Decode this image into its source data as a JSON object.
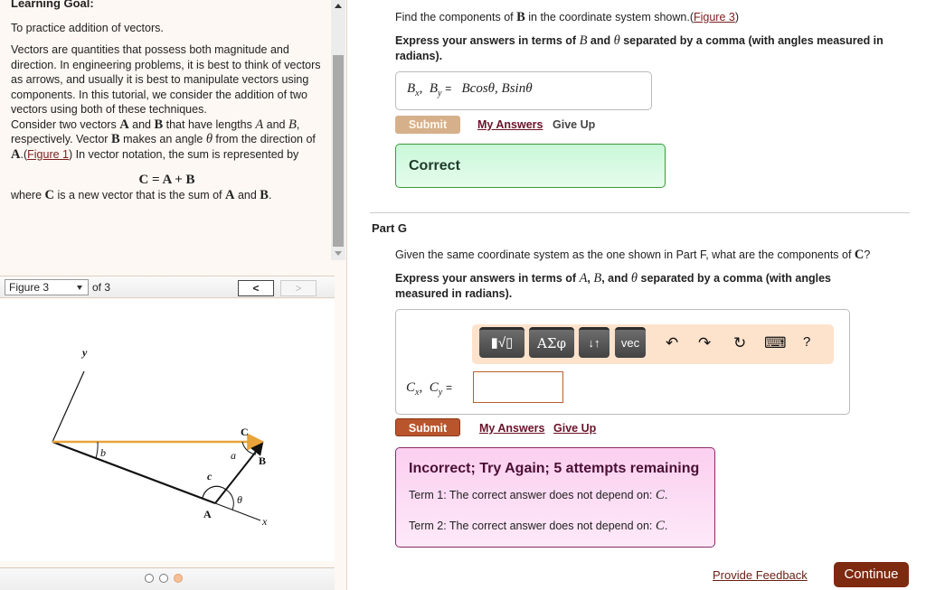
{
  "learning_goal": {
    "heading": "Learning Goal:",
    "intro": "To practice addition of vectors.",
    "paragraph1": "Vectors are quantities that possess both magnitude and direction. In engineering problems, it is best to think of vectors as arrows, and usually it is best to manipulate vectors using components. In this tutorial, we consider the addition of two vectors using both of these techniques.",
    "p2_a": "Consider two vectors ",
    "vec_A": "A",
    "p2_b": " and ",
    "vec_B": "B",
    "p2_c": " that have lengths ",
    "len_A": "A",
    "p2_d": " and ",
    "len_B": "B",
    "p2_e": ", respectively. Vector ",
    "p2_f": " makes an angle ",
    "theta": "θ",
    "p2_g": " from the direction of ",
    "p2_h": ".(",
    "figure_link": "Figure 1",
    "p2_i": ") In vector notation, the sum is represented by",
    "equation": "C = A + B",
    "where_a": "where ",
    "vec_C": "C",
    "where_b": " is a new vector that is the sum of ",
    "where_c": " and ",
    "where_d": "."
  },
  "figure_nav": {
    "selected": "Figure 3",
    "of_label": "of 3",
    "prev": "<",
    "next": ">",
    "current_page": 3,
    "total_pages": 3
  },
  "figure": {
    "labels": {
      "y": "y",
      "x": "x",
      "b": "b",
      "C": "C",
      "a": "a",
      "B": "B",
      "c": "c",
      "theta": "θ",
      "A": "A"
    },
    "colors": {
      "resultant": "#e8a33a",
      "vector": "#111111"
    }
  },
  "part_f": {
    "question_a": "Find the components of ",
    "question_vec": "B",
    "question_b": " in the coordinate system shown.(",
    "figure_link": "Figure 3",
    "question_c": ")",
    "instruction_a": "Express your answers in terms of ",
    "instruction_B": "B",
    "instruction_b": " and ",
    "instruction_theta": "θ",
    "instruction_c": " separated by a comma (with angles measured in radians).",
    "answer_label_1": "B",
    "answer_sub_1": "x",
    "answer_label_2": "B",
    "answer_sub_2": "y",
    "answer_equals": "=",
    "answer_value": "Bcosθ, Bsinθ",
    "submit": "Submit",
    "my_answers": "My Answers",
    "give_up": "Give Up",
    "result": "Correct"
  },
  "part_g": {
    "title": "Part G",
    "question_a": "Given the same coordinate system as the one shown in Part F, what are the components of ",
    "question_vec": "C",
    "question_b": "?",
    "instruction_a": "Express your answers in terms of ",
    "instruction_A": "A",
    "instruction_sep1": ", ",
    "instruction_B": "B",
    "instruction_sep2": ", and ",
    "instruction_theta": "θ",
    "instruction_b": " separated by a comma (with angles measured in radians).",
    "toolbar": {
      "templates": "▮√▯",
      "greek": "ΑΣφ",
      "arrows": "↓↑",
      "vec": "vec",
      "undo": "↶",
      "redo": "↷",
      "reset": "↻",
      "keyboard": "⌨",
      "help": "?"
    },
    "answer_label_1": "C",
    "answer_sub_1": "x",
    "answer_label_2": "C",
    "answer_sub_2": "y",
    "answer_equals": "=",
    "answer_value": "",
    "submit": "Submit",
    "my_answers": "My Answers",
    "give_up": "Give Up",
    "feedback_title": "Incorrect; Try Again; 5 attempts remaining",
    "term1": "Term 1: The correct answer does not depend on: ",
    "term1_var": "C",
    "term2": "Term 2: The correct answer does not depend on: ",
    "term2_var": "C",
    "attempts_remaining": 5
  },
  "footer": {
    "provide_feedback": "Provide Feedback",
    "continue": "Continue"
  }
}
